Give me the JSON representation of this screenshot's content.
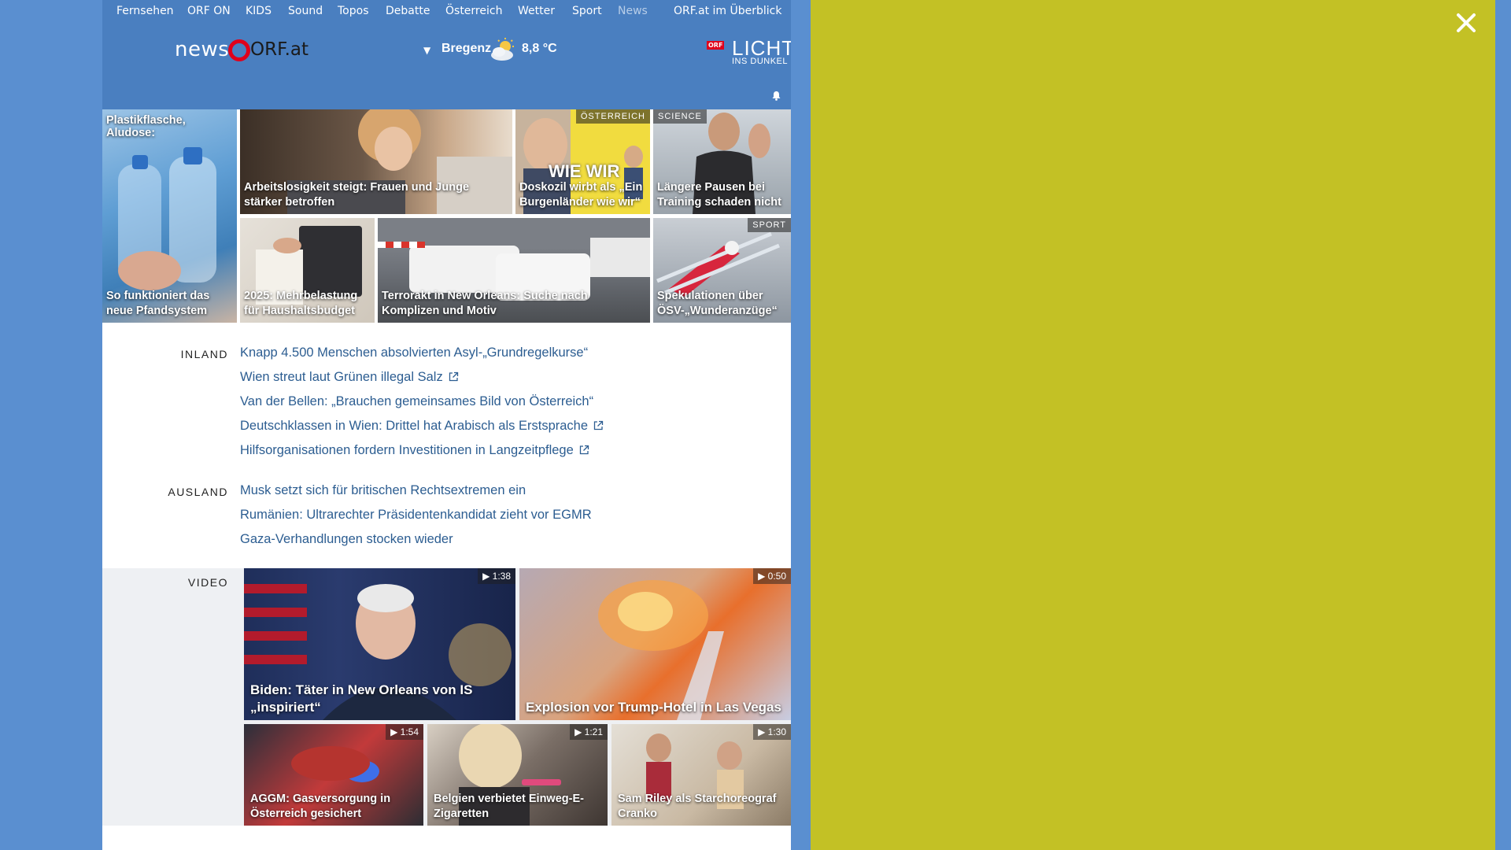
{
  "nav": {
    "items": [
      "Fernsehen",
      "ORF ON",
      "KIDS",
      "Sound",
      "Topos",
      "Debatte",
      "Österreich",
      "Wetter",
      "Sport",
      "News",
      "ORF.at im Überblick"
    ]
  },
  "header": {
    "logo_news": "news",
    "logo_orf": "ORF.at",
    "weather_city": "Bregenz",
    "weather_temp": "8,8 °C",
    "licht_badge": "ORF",
    "licht_main": "LICHT",
    "licht_sub": "INS DUNKEL"
  },
  "tiles": [
    {
      "top_caption": "Plastikflasche, Aludose:",
      "caption": "So funktioniert das neue Pfandsystem"
    },
    {
      "caption": "Arbeitslosigkeit steigt: Frauen und Junge stärker betroffen"
    },
    {
      "tag": "ÖSTERREICH",
      "caption": "Doskozil wirbt als „Ein Burgenländer wie wir“",
      "poster_text": "WIE WIR"
    },
    {
      "tag": "SCIENCE",
      "caption": "Längere Pausen bei Training schaden nicht"
    },
    {
      "caption": "2025: Mehrbelastung für Haushaltsbudget"
    },
    {
      "caption": "Terrorakt in New Orleans: Suche nach Komplizen und Motiv"
    },
    {
      "tag": "SPORT",
      "caption": "Spekulationen über ÖSV-„Wunderanzüge“"
    }
  ],
  "sections": {
    "inland": {
      "label": "INLAND",
      "links": [
        "Knapp 4.500 Menschen absolvierten Asyl-„Grundregelkurse“",
        "Wien streut laut Grünen illegal Salz",
        "Van der Bellen: „Brauchen gemeinsames Bild von Österreich“",
        "Deutschklassen in Wien: Drittel hat Arabisch als Erstsprache",
        "Hilfsorganisationen fordern Investitionen in Langzeitpflege"
      ]
    },
    "ausland": {
      "label": "AUSLAND",
      "links": [
        "Musk setzt sich für britischen Rechtsextremen ein",
        "Rumänien: Ultrarechter Präsidentenkandidat zieht vor EGMR",
        "Gaza-Verhandlungen stocken wieder"
      ]
    },
    "video": {
      "label": "VIDEO",
      "items": [
        {
          "duration": "1:38",
          "caption": "Biden: Täter in New Orleans von IS „inspiriert“"
        },
        {
          "duration": "0:50",
          "caption": "Explosion vor Trump-Hotel in Las Vegas"
        },
        {
          "duration": "1:54",
          "caption": "AGGM: Gasversorgung in Österreich gesichert"
        },
        {
          "duration": "1:21",
          "caption": "Belgien verbietet Einweg-E-Zigaretten"
        },
        {
          "duration": "1:30",
          "caption": "Sam Riley als Starchoreograf Cranko"
        }
      ]
    }
  },
  "icons": {
    "close": "close-icon",
    "bell": "bell-icon",
    "external": "external-link-icon",
    "play": "play-icon",
    "weather": "partly-cloudy-icon"
  },
  "colors": {
    "nav_blue": "#4a7fc0",
    "background_blue": "#5a8fd0",
    "link_blue": "#2c5d91",
    "overlay_yellow": "#c3c125",
    "orf_red": "#e0001b"
  }
}
